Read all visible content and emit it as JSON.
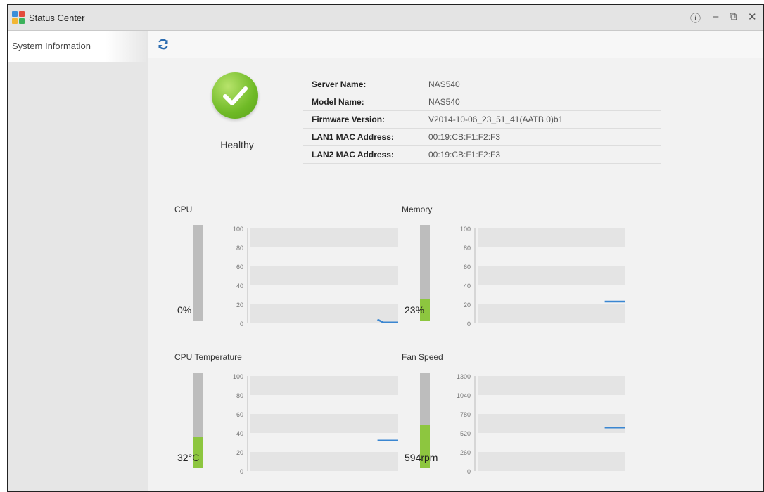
{
  "window": {
    "title": "Status Center"
  },
  "sidebar": {
    "items": [
      {
        "label": "System Information"
      }
    ]
  },
  "health": {
    "status": "Healthy"
  },
  "info": {
    "rows": [
      {
        "key": "Server Name:",
        "value": "NAS540"
      },
      {
        "key": "Model Name:",
        "value": "NAS540"
      },
      {
        "key": "Firmware Version:",
        "value": "V2014-10-06_23_51_41(AATB.0)b1"
      },
      {
        "key": "LAN1 MAC Address:",
        "value": "00:19:CB:F1:F2:F3"
      },
      {
        "key": "LAN2 MAC Address:",
        "value": "00:19:CB:F1:F2:F3"
      }
    ]
  },
  "colors": {
    "gauge_fill": "#8dc63f",
    "line": "#3a86d1",
    "band": "#e4e4e4"
  },
  "chart_data": [
    {
      "type": "line",
      "title": "CPU",
      "gauge_value": "0%",
      "gauge_fraction": 0.0,
      "yticks": [
        "100",
        "80",
        "60",
        "40",
        "20",
        "0"
      ],
      "ylim": [
        0,
        100
      ],
      "series": [
        {
          "x": [
            0.86,
            0.9,
            1.0
          ],
          "y": [
            4,
            1,
            1
          ]
        }
      ]
    },
    {
      "type": "line",
      "title": "Memory",
      "gauge_value": "23%",
      "gauge_fraction": 0.23,
      "yticks": [
        "100",
        "80",
        "60",
        "40",
        "20",
        "0"
      ],
      "ylim": [
        0,
        100
      ],
      "series": [
        {
          "x": [
            0.86,
            1.0
          ],
          "y": [
            23,
            23
          ]
        }
      ]
    },
    {
      "type": "line",
      "title": "CPU Temperature",
      "gauge_value": "32°C",
      "gauge_fraction": 0.32,
      "yticks": [
        "100",
        "80",
        "60",
        "40",
        "20",
        "0"
      ],
      "ylim": [
        0,
        100
      ],
      "series": [
        {
          "x": [
            0.86,
            1.0
          ],
          "y": [
            32,
            32
          ]
        }
      ]
    },
    {
      "type": "line",
      "title": "Fan Speed",
      "gauge_value": "594rpm",
      "gauge_fraction": 0.457,
      "yticks": [
        "1300",
        "1040",
        "780",
        "520",
        "260",
        "0"
      ],
      "ylim": [
        0,
        1300
      ],
      "series": [
        {
          "x": [
            0.86,
            1.0
          ],
          "y": [
            594,
            594
          ]
        }
      ]
    }
  ]
}
